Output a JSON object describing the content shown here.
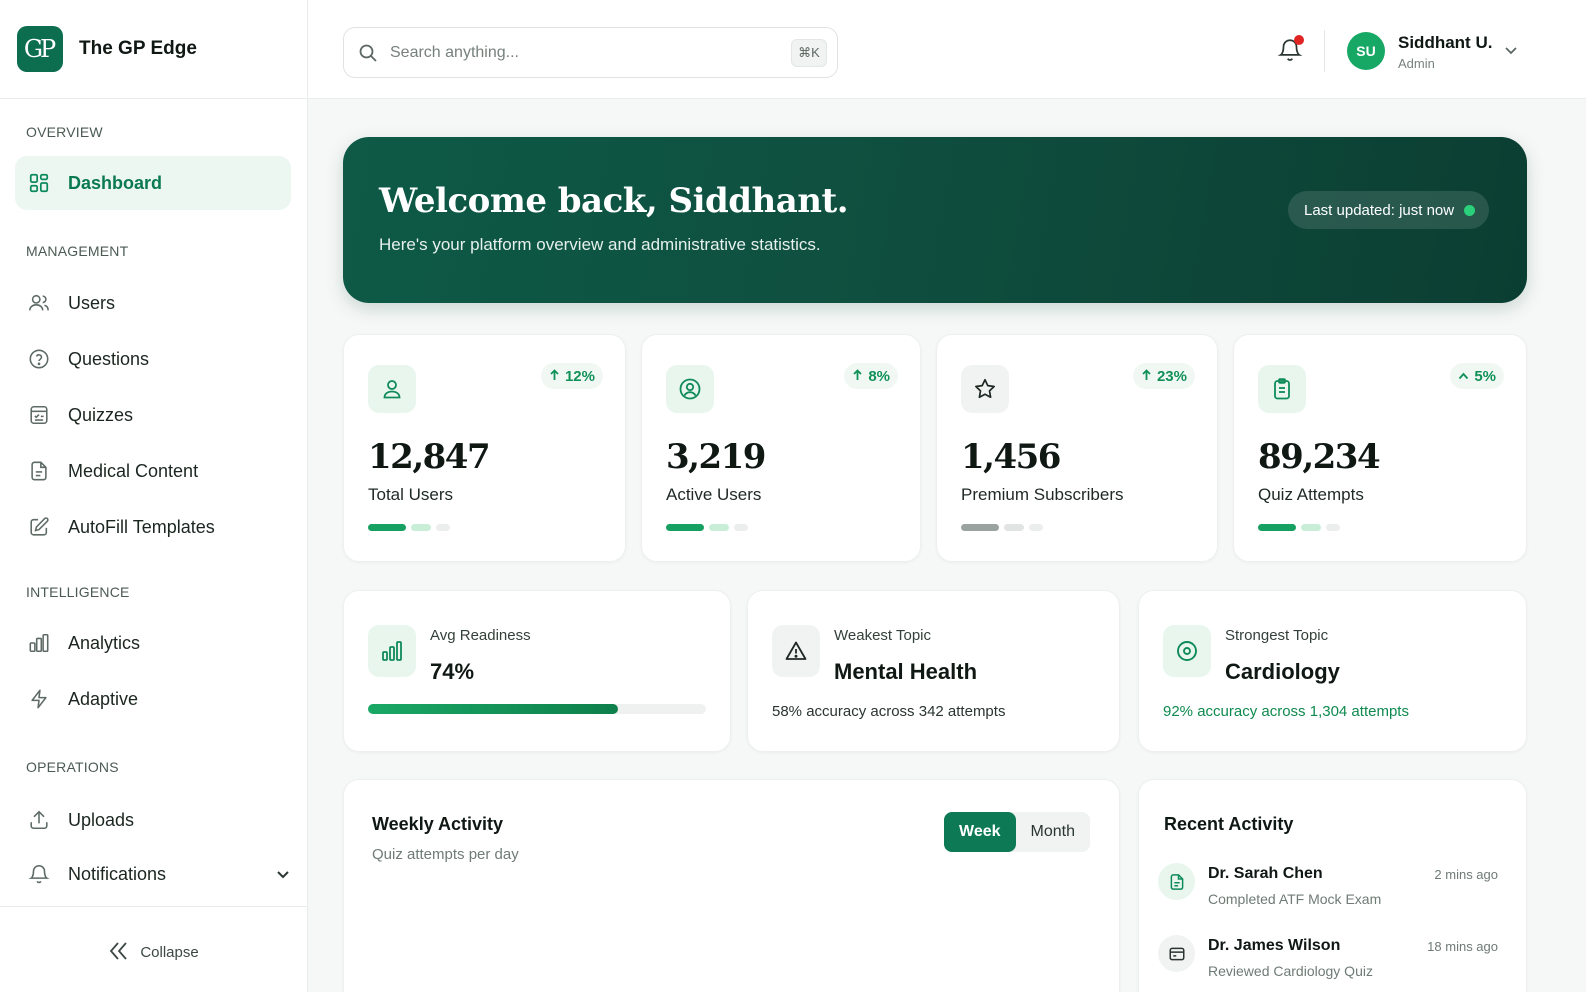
{
  "brand": {
    "logo_text": "GP",
    "name": "The GP Edge"
  },
  "sidebar": {
    "sections": {
      "overview": "OVERVIEW",
      "management": "MANAGEMENT",
      "intelligence": "INTELLIGENCE",
      "operations": "OPERATIONS"
    },
    "items": {
      "dashboard": "Dashboard",
      "users": "Users",
      "questions": "Questions",
      "quizzes": "Quizzes",
      "medical_content": "Medical Content",
      "autofill_templates": "AutoFill Templates",
      "analytics": "Analytics",
      "adaptive": "Adaptive",
      "uploads": "Uploads",
      "notifications": "Notifications"
    },
    "active_item": "dashboard",
    "collapse_label": "Collapse"
  },
  "topbar": {
    "search_placeholder": "Search anything...",
    "search_shortcut": "⌘K",
    "user": {
      "initials": "SU",
      "name": "Siddhant U.",
      "role": "Admin"
    },
    "notification_unread": true
  },
  "hero": {
    "title": "Welcome back, Siddhant.",
    "subtitle": "Here's your platform overview and administrative statistics.",
    "status": "Last updated: just now"
  },
  "stats": [
    {
      "icon": "user-icon",
      "value": "12,847",
      "label": "Total Users",
      "trend": "12%"
    },
    {
      "icon": "user-circle-icon",
      "value": "3,219",
      "label": "Active Users",
      "trend": "8%"
    },
    {
      "icon": "star-icon",
      "value": "1,456",
      "label": "Premium Subscribers",
      "trend": "23%"
    },
    {
      "icon": "clipboard-icon",
      "value": "89,234",
      "label": "Quiz Attempts",
      "trend": "5%"
    }
  ],
  "insights": {
    "readiness": {
      "label": "Avg Readiness",
      "value": "74%",
      "progress": 0.74
    },
    "weakest": {
      "label": "Weakest Topic",
      "value": "Mental Health",
      "note": "58% accuracy across 342 attempts"
    },
    "strongest": {
      "label": "Strongest Topic",
      "value": "Cardiology",
      "note": "92% accuracy across 1,304 attempts"
    }
  },
  "weekly_activity": {
    "title": "Weekly Activity",
    "subtitle": "Quiz attempts per day",
    "toggle": {
      "week": "Week",
      "month": "Month",
      "selected": "week"
    }
  },
  "recent_activity": {
    "title": "Recent Activity",
    "items": [
      {
        "icon": "document-icon",
        "name": "Dr. Sarah Chen",
        "desc": "Completed ATF Mock Exam",
        "time": "2 mins ago"
      },
      {
        "icon": "card-icon",
        "name": "Dr. James Wilson",
        "desc": "Reviewed Cardiology Quiz",
        "time": "18 mins ago"
      }
    ]
  },
  "colors": {
    "brand": "#0d6e4f",
    "accent": "#0d8a5b",
    "hero_start": "#0e5a47",
    "hero_end": "#0b3e32",
    "positive": "#119158",
    "alert": "#e02424"
  }
}
